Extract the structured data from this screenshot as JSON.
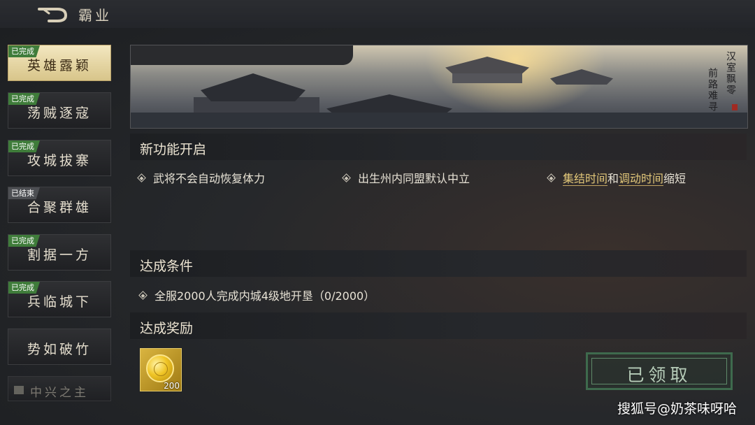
{
  "header": {
    "title": "霸业",
    "back_icon": "back-arrow-icon"
  },
  "sidebar": {
    "stages": [
      {
        "label": "英雄露颖",
        "status": "已完成",
        "active": true
      },
      {
        "label": "荡贼逐寇",
        "status": "已完成"
      },
      {
        "label": "攻城拔寨",
        "status": "已完成"
      },
      {
        "label": "合聚群雄",
        "status": "已结束"
      },
      {
        "label": "割据一方",
        "status": "已完成"
      },
      {
        "label": "兵临城下",
        "status": "已完成"
      },
      {
        "label": "势如破竹",
        "status": ""
      },
      {
        "label": "中兴之主",
        "status": "",
        "locked": true
      }
    ]
  },
  "banner": {
    "poem_col1": "汉室飘零",
    "poem_col2": "前路难寻"
  },
  "features": {
    "title": "新功能开启",
    "items": [
      "武将不会自动恢复体力",
      "出生州内同盟默认中立"
    ],
    "item3": {
      "link1": "集结时间",
      "joiner": "和",
      "link2": "调动时间",
      "suffix": "缩短"
    }
  },
  "conditions": {
    "title": "达成条件",
    "item": "全服2000人完成内城4级地开垦（0/2000）"
  },
  "rewards": {
    "title": "达成奖励",
    "items": [
      {
        "icon": "gold-coin-icon",
        "count": "200"
      }
    ],
    "claim_label": "已领取"
  },
  "watermark": "搜狐号@奶茶味呀哈",
  "colors": {
    "accent_gold": "#e3c87a",
    "badge_green": "#3f7c3a",
    "claimed_green": "#3e6a4d"
  }
}
